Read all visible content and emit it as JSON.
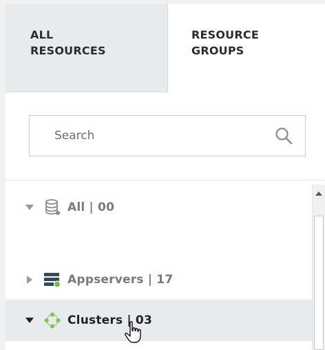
{
  "tabs": [
    {
      "line1": "ALL",
      "line2": "RESOURCES",
      "active": true
    },
    {
      "line1": "RESOURCE",
      "line2": "GROUPS",
      "active": false
    }
  ],
  "search": {
    "placeholder": "Search",
    "value": ""
  },
  "tree": [
    {
      "label": "All | 00",
      "expanded": true,
      "icon": "database-icon"
    },
    {
      "label": "Appservers | 17",
      "expanded": false,
      "icon": "server-status-icon"
    },
    {
      "label": "Clusters | 03",
      "expanded": true,
      "icon": "cluster-icon",
      "selected": true
    }
  ],
  "colors": {
    "tab_active_bg": "#e8ebee",
    "cluster_green": "#7cc352",
    "server_dark": "#3a4a55"
  }
}
